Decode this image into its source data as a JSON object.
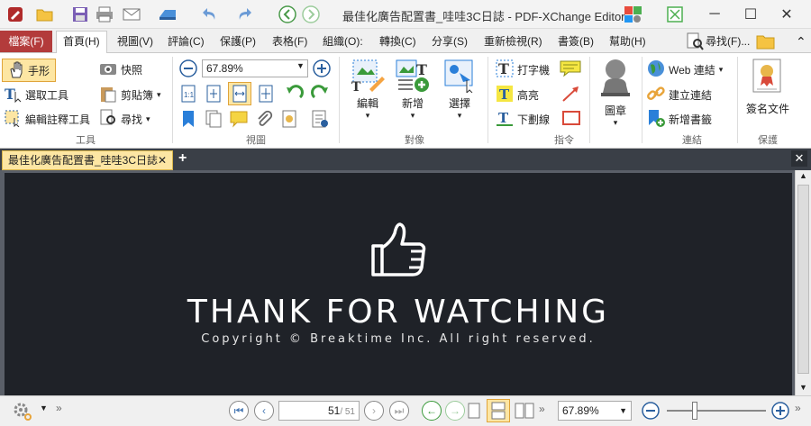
{
  "window": {
    "title": "最佳化廣告配置書_哇哇3C日誌 - PDF-XChange Editor"
  },
  "menu": {
    "file": "檔案(F)",
    "items": [
      "首頁(H)",
      "視圖(V)",
      "評論(C)",
      "保護(P)",
      "表格(F)",
      "組織(O):",
      "轉換(C)",
      "分享(S)",
      "重新檢視(R)",
      "書簽(B)",
      "幫助(H)"
    ],
    "search": "尋找(F)..."
  },
  "ribbon": {
    "tools": {
      "hand": "手形",
      "select": "選取工具",
      "edit_annot": "編輯註釋工具",
      "snapshot": "快照",
      "clipboard": "剪貼簿",
      "find": "尋找",
      "label": "工具"
    },
    "view": {
      "zoom": "67.89%",
      "label": "視圖"
    },
    "objects": {
      "edit": "編輯",
      "new": "新增",
      "select": "選擇",
      "label": "對像"
    },
    "commands": {
      "typewriter": "打字機",
      "highlight": "高亮",
      "underline": "下劃線",
      "label": "指令"
    },
    "stamp": {
      "label": "圖章"
    },
    "links": {
      "web": "Web 連結",
      "create": "建立連結",
      "bookmark": "新增書籤",
      "label": "連結"
    },
    "protect": {
      "sign": "簽名文件",
      "label": "保護"
    }
  },
  "tab": {
    "name": "最佳化廣告配置書_哇哇3C日誌"
  },
  "document": {
    "heading": "THANK FOR WATCHING",
    "copyright": "Copyright © Breaktime Inc. All right reserved."
  },
  "status": {
    "page_current": "51",
    "page_total": "/ 51",
    "zoom": "67.89%"
  }
}
